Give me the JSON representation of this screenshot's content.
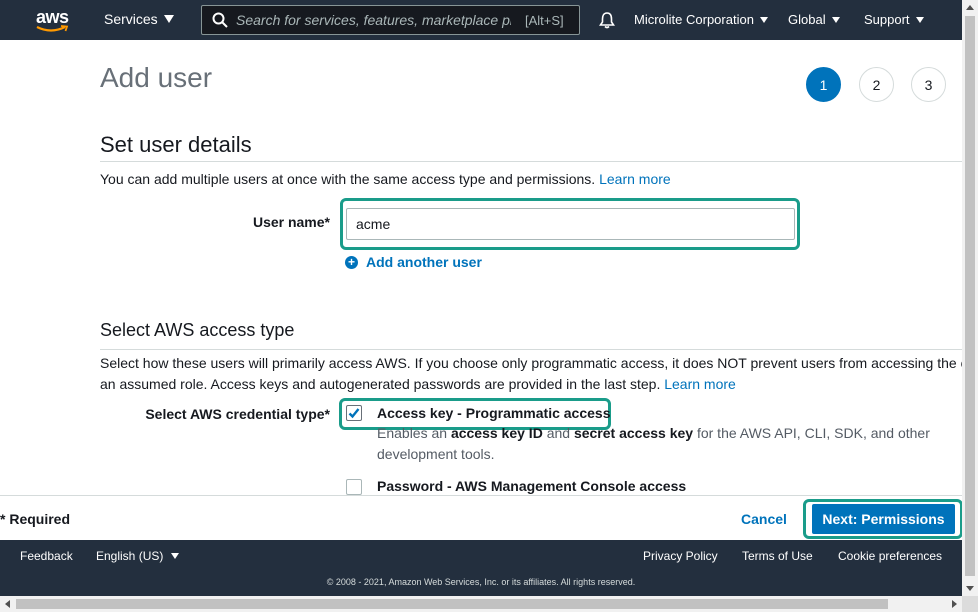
{
  "topnav": {
    "logo_text": "aws",
    "services_label": "Services",
    "search_placeholder": "Search for services, features, marketplace products, and docs",
    "search_shortcut": "[Alt+S]",
    "account_label": "Microlite Corporation",
    "region_label": "Global",
    "support_label": "Support"
  },
  "page": {
    "title": "Add user",
    "steps": [
      "1",
      "2",
      "3"
    ],
    "active_step": "1"
  },
  "user_details": {
    "heading": "Set user details",
    "description": "You can add multiple users at once with the same access type and permissions.",
    "learn_more": "Learn more",
    "user_name_label": "User name*",
    "user_name_value": "acme",
    "add_another_user": "Add another user"
  },
  "access_type": {
    "heading": "Select AWS access type",
    "description_line1": "Select how these users will primarily access AWS. If you choose only programmatic access, it does NOT prevent users from accessing the c",
    "description_line2": "an assumed role. Access keys and autogenerated passwords are provided in the last step.",
    "learn_more": "Learn more",
    "credential_label": "Select AWS credential type*",
    "options": [
      {
        "label": "Access key - Programmatic access",
        "checked": true,
        "desc_pre": "Enables an ",
        "desc_b1": "access key ID",
        "desc_mid": " and ",
        "desc_b2": "secret access key",
        "desc_post": " for the AWS API, CLI, SDK, and other",
        "desc_line2": "development tools."
      },
      {
        "label": "Password - AWS Management Console access",
        "checked": false
      }
    ]
  },
  "actions": {
    "required_note": "* Required",
    "cancel": "Cancel",
    "next": "Next: Permissions"
  },
  "footer": {
    "feedback": "Feedback",
    "language": "English (US)",
    "privacy": "Privacy Policy",
    "terms": "Terms of Use",
    "cookies": "Cookie preferences",
    "copyright": "© 2008 - 2021, Amazon Web Services, Inc. or its affiliates. All rights reserved."
  },
  "colors": {
    "nav_bg": "#232f3e",
    "link": "#0073bb",
    "highlight": "#1a9c8a"
  }
}
